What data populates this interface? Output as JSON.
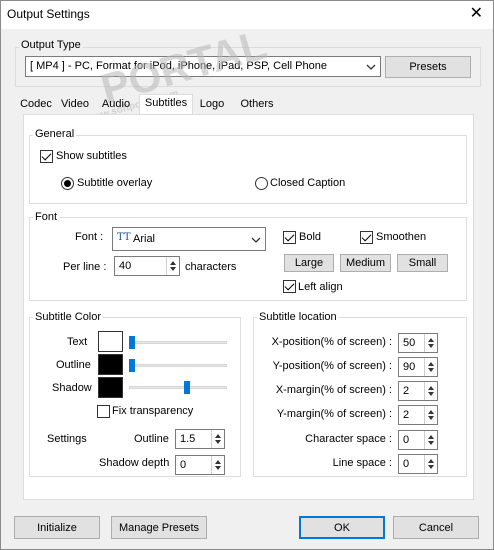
{
  "window": {
    "title": "Output Settings",
    "close_glyph": "✕"
  },
  "output_type": {
    "group_label": "Output Type",
    "selected": "[ MP4 ] - PC, Format for iPod, iPhone, iPad, PSP, Cell Phone",
    "presets_label": "Presets"
  },
  "watermark": {
    "brand": "PORTAL",
    "site": "www.softportal.com"
  },
  "tabs": [
    {
      "label": "Codec"
    },
    {
      "label": "Video"
    },
    {
      "label": "Audio"
    },
    {
      "label": "Subtitles",
      "selected": true
    },
    {
      "label": "Logo"
    },
    {
      "label": "Others"
    }
  ],
  "general": {
    "group_label": "General",
    "show_subtitles": {
      "label": "Show subtitles",
      "checked": true
    },
    "overlay": {
      "label": "Subtitle overlay",
      "checked": true
    },
    "caption": {
      "label": "Closed Caption",
      "checked": false
    }
  },
  "font": {
    "group_label": "Font",
    "font_label": "Font :",
    "font_value": "Arial",
    "font_icon_glyph": "TT",
    "perline_label": "Per line :",
    "perline_value": "40",
    "characters_label": "characters",
    "bold": {
      "label": "Bold",
      "checked": true
    },
    "smoothen": {
      "label": "Smoothen",
      "checked": true
    },
    "large_label": "Large",
    "medium_label": "Medium",
    "small_label": "Small",
    "leftalign": {
      "label": "Left align",
      "checked": true
    }
  },
  "color": {
    "group_label": "Subtitle Color",
    "text_label": "Text",
    "outline_label": "Outline",
    "shadow_label": "Shadow",
    "text_color": "#ffffff",
    "outline_color": "#000000",
    "shadow_color": "#000000",
    "text_level": 0.0,
    "outline_level": 0.0,
    "shadow_level": 0.6,
    "fix_transparency": {
      "label": "Fix transparency",
      "checked": false
    },
    "settings_label": "Settings",
    "outline_setting_label": "Outline",
    "outline_setting_value": "1.5",
    "shadow_depth_label": "Shadow depth",
    "shadow_depth_value": "0"
  },
  "location": {
    "group_label": "Subtitle location",
    "rows": [
      {
        "label": "X-position(% of screen) :",
        "value": "50"
      },
      {
        "label": "Y-position(% of screen) :",
        "value": "90"
      },
      {
        "label": "X-margin(% of screen) :",
        "value": "2"
      },
      {
        "label": "Y-margin(% of screen) :",
        "value": "2"
      },
      {
        "label": "Character space :",
        "value": "0"
      },
      {
        "label": "Line space :",
        "value": "0"
      }
    ]
  },
  "footer": {
    "initialize_label": "Initialize",
    "manage_label": "Manage Presets",
    "ok_label": "OK",
    "cancel_label": "Cancel"
  },
  "accent": "#0078d7"
}
